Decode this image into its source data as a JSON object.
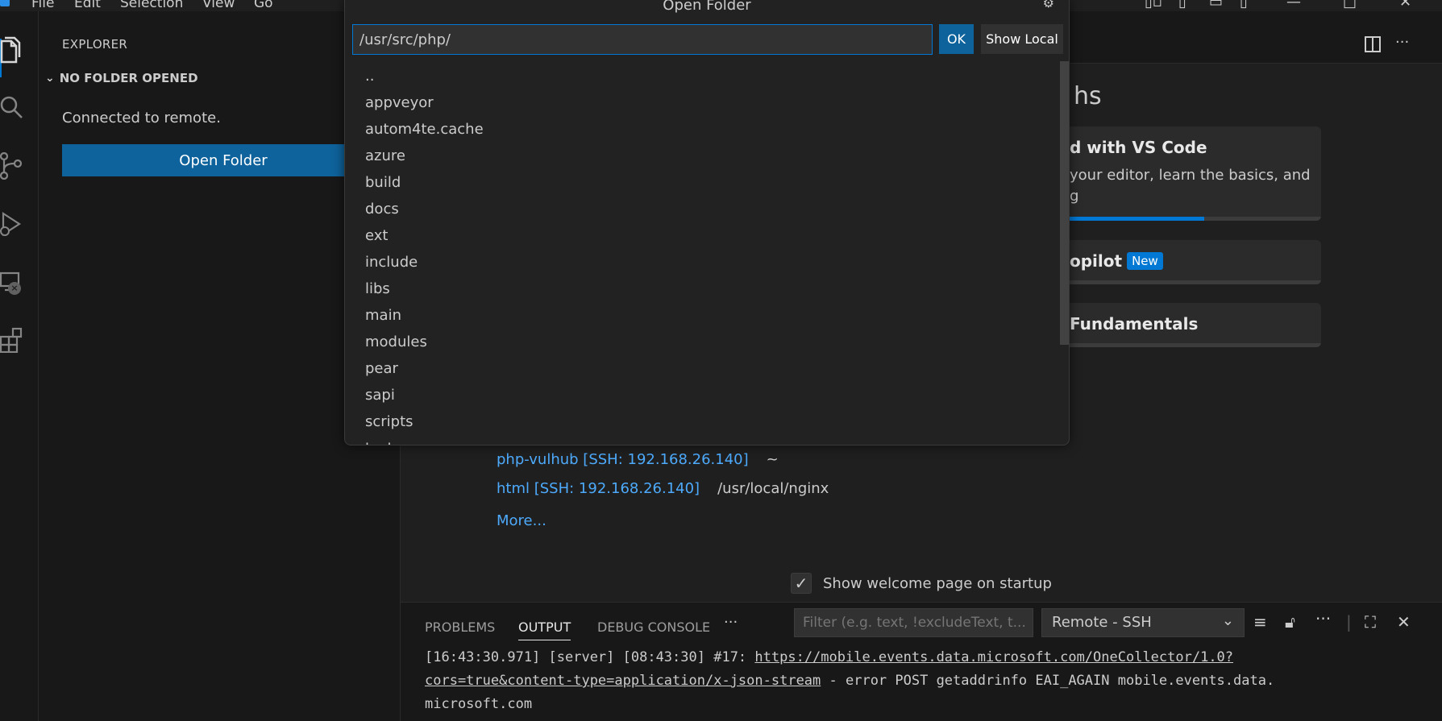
{
  "titlebar": {
    "menu": [
      "File",
      "Edit",
      "Selection",
      "View",
      "Go"
    ],
    "more": "···"
  },
  "sidebar": {
    "title": "EXPLORER",
    "section": "NO FOLDER OPENED",
    "connected_text": "Connected to remote.",
    "open_folder_label": "Open Folder"
  },
  "quickpick": {
    "title": "Open Folder",
    "input_value": "/usr/src/php/",
    "ok_label": "OK",
    "show_local_label": "Show Local",
    "items": [
      "..",
      "appveyor",
      "autom4te.cache",
      "azure",
      "build",
      "docs",
      "ext",
      "include",
      "libs",
      "main",
      "modules",
      "pear",
      "sapi",
      "scripts",
      "tests"
    ]
  },
  "welcome": {
    "walkthroughs_heading": "hs",
    "cards": [
      {
        "title": "d with VS Code",
        "desc_line1": "your editor, learn the basics, and",
        "desc_line2": "g",
        "progress_pct": 60
      },
      {
        "title": "opilot",
        "badge": "New",
        "progress_pct": 1.5
      },
      {
        "title": "Fundamentals",
        "progress_pct": 0
      }
    ],
    "recent": [
      {
        "name": "php-vulhub [SSH: 192.168.26.140]",
        "path": "~"
      },
      {
        "name": "html [SSH: 192.168.26.140]",
        "path": "/usr/local/nginx"
      }
    ],
    "more_label": "More...",
    "startup_label": "Show welcome page on startup",
    "startup_checked": true
  },
  "panel": {
    "tabs": [
      "PROBLEMS",
      "OUTPUT",
      "DEBUG CONSOLE"
    ],
    "active_tab": "OUTPUT",
    "more": "···",
    "filter_placeholder": "Filter (e.g. text, !excludeText, t...",
    "channel": "Remote - SSH",
    "log": {
      "prefix": "[16:43:30.971] [server] [08:43:30] #17: ",
      "url_part1": "https://mobile.events.data.microsoft.com/OneCollector/1.0?",
      "url_part2": "cors=true&content-type=application/x-json-stream",
      "suffix_line2": " - error POST getaddrinfo EAI_AGAIN mobile.events.data.",
      "line3": "microsoft.com"
    }
  },
  "colors": {
    "accent": "#0078d4",
    "button": "#0e639c",
    "link": "#4daafc",
    "background": "#1f1f1f",
    "sidebar_bg": "#181818"
  }
}
